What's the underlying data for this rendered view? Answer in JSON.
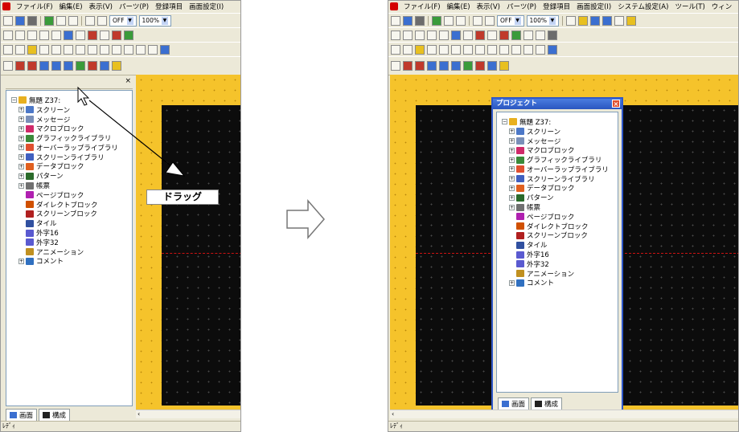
{
  "left_window": {
    "menu": [
      "ファイル(F)",
      "編集(E)",
      "表示(V)",
      "パーツ(P)",
      "登録項目",
      "画面設定(I)"
    ],
    "toolbar": {
      "mode_select": "OFF",
      "zoom_select": "100%"
    },
    "tree": {
      "root": "無題 Z37:",
      "items": [
        {
          "label": "スクリーン",
          "expandable": true,
          "color": "#4c78c8"
        },
        {
          "label": "メッセージ",
          "expandable": true,
          "color": "#7a8fb8"
        },
        {
          "label": "マクロブロック",
          "expandable": true,
          "color": "#d02a6a"
        },
        {
          "label": "グラフィックライブラリ",
          "expandable": true,
          "color": "#3a8a3a"
        },
        {
          "label": "オーバーラップライブラリ",
          "expandable": true,
          "color": "#e05030"
        },
        {
          "label": "スクリーンライブラリ",
          "expandable": true,
          "color": "#4060c0"
        },
        {
          "label": "データブロック",
          "expandable": true,
          "color": "#e06020"
        },
        {
          "label": "パターン",
          "expandable": true,
          "color": "#2a6a2a"
        },
        {
          "label": "帳票",
          "expandable": true,
          "color": "#707070"
        },
        {
          "label": "ページブロック",
          "expandable": false,
          "color": "#b020b0"
        },
        {
          "label": "ダイレクトブロック",
          "expandable": false,
          "color": "#d05000"
        },
        {
          "label": "スクリーンブロック",
          "expandable": false,
          "color": "#b02020"
        },
        {
          "label": "タイル",
          "expandable": false,
          "color": "#3050a0"
        },
        {
          "label": "外字16",
          "expandable": false,
          "color": "#5a5ad0"
        },
        {
          "label": "外字32",
          "expandable": false,
          "color": "#5a5ad0"
        },
        {
          "label": "アニメーション",
          "expandable": false,
          "color": "#c09020"
        },
        {
          "label": "コメント",
          "expandable": true,
          "color": "#3070c0"
        }
      ]
    },
    "tabs": [
      "画面",
      "構成"
    ],
    "status": "ﾚﾃﾞｨ",
    "drag_label": "ドラッグ"
  },
  "right_window": {
    "menu": [
      "ファイル(F)",
      "編集(E)",
      "表示(V)",
      "パーツ(P)",
      "登録項目",
      "画面設定(I)",
      "システム設定(A)",
      "ツール(T)",
      "ウィン"
    ],
    "toolbar": {
      "mode_select": "OFF",
      "zoom_select": "100%"
    },
    "project_window": {
      "title": "プロジェクト",
      "tabs": [
        "画面",
        "構成"
      ]
    },
    "status": "ﾚﾃﾞｨ"
  }
}
